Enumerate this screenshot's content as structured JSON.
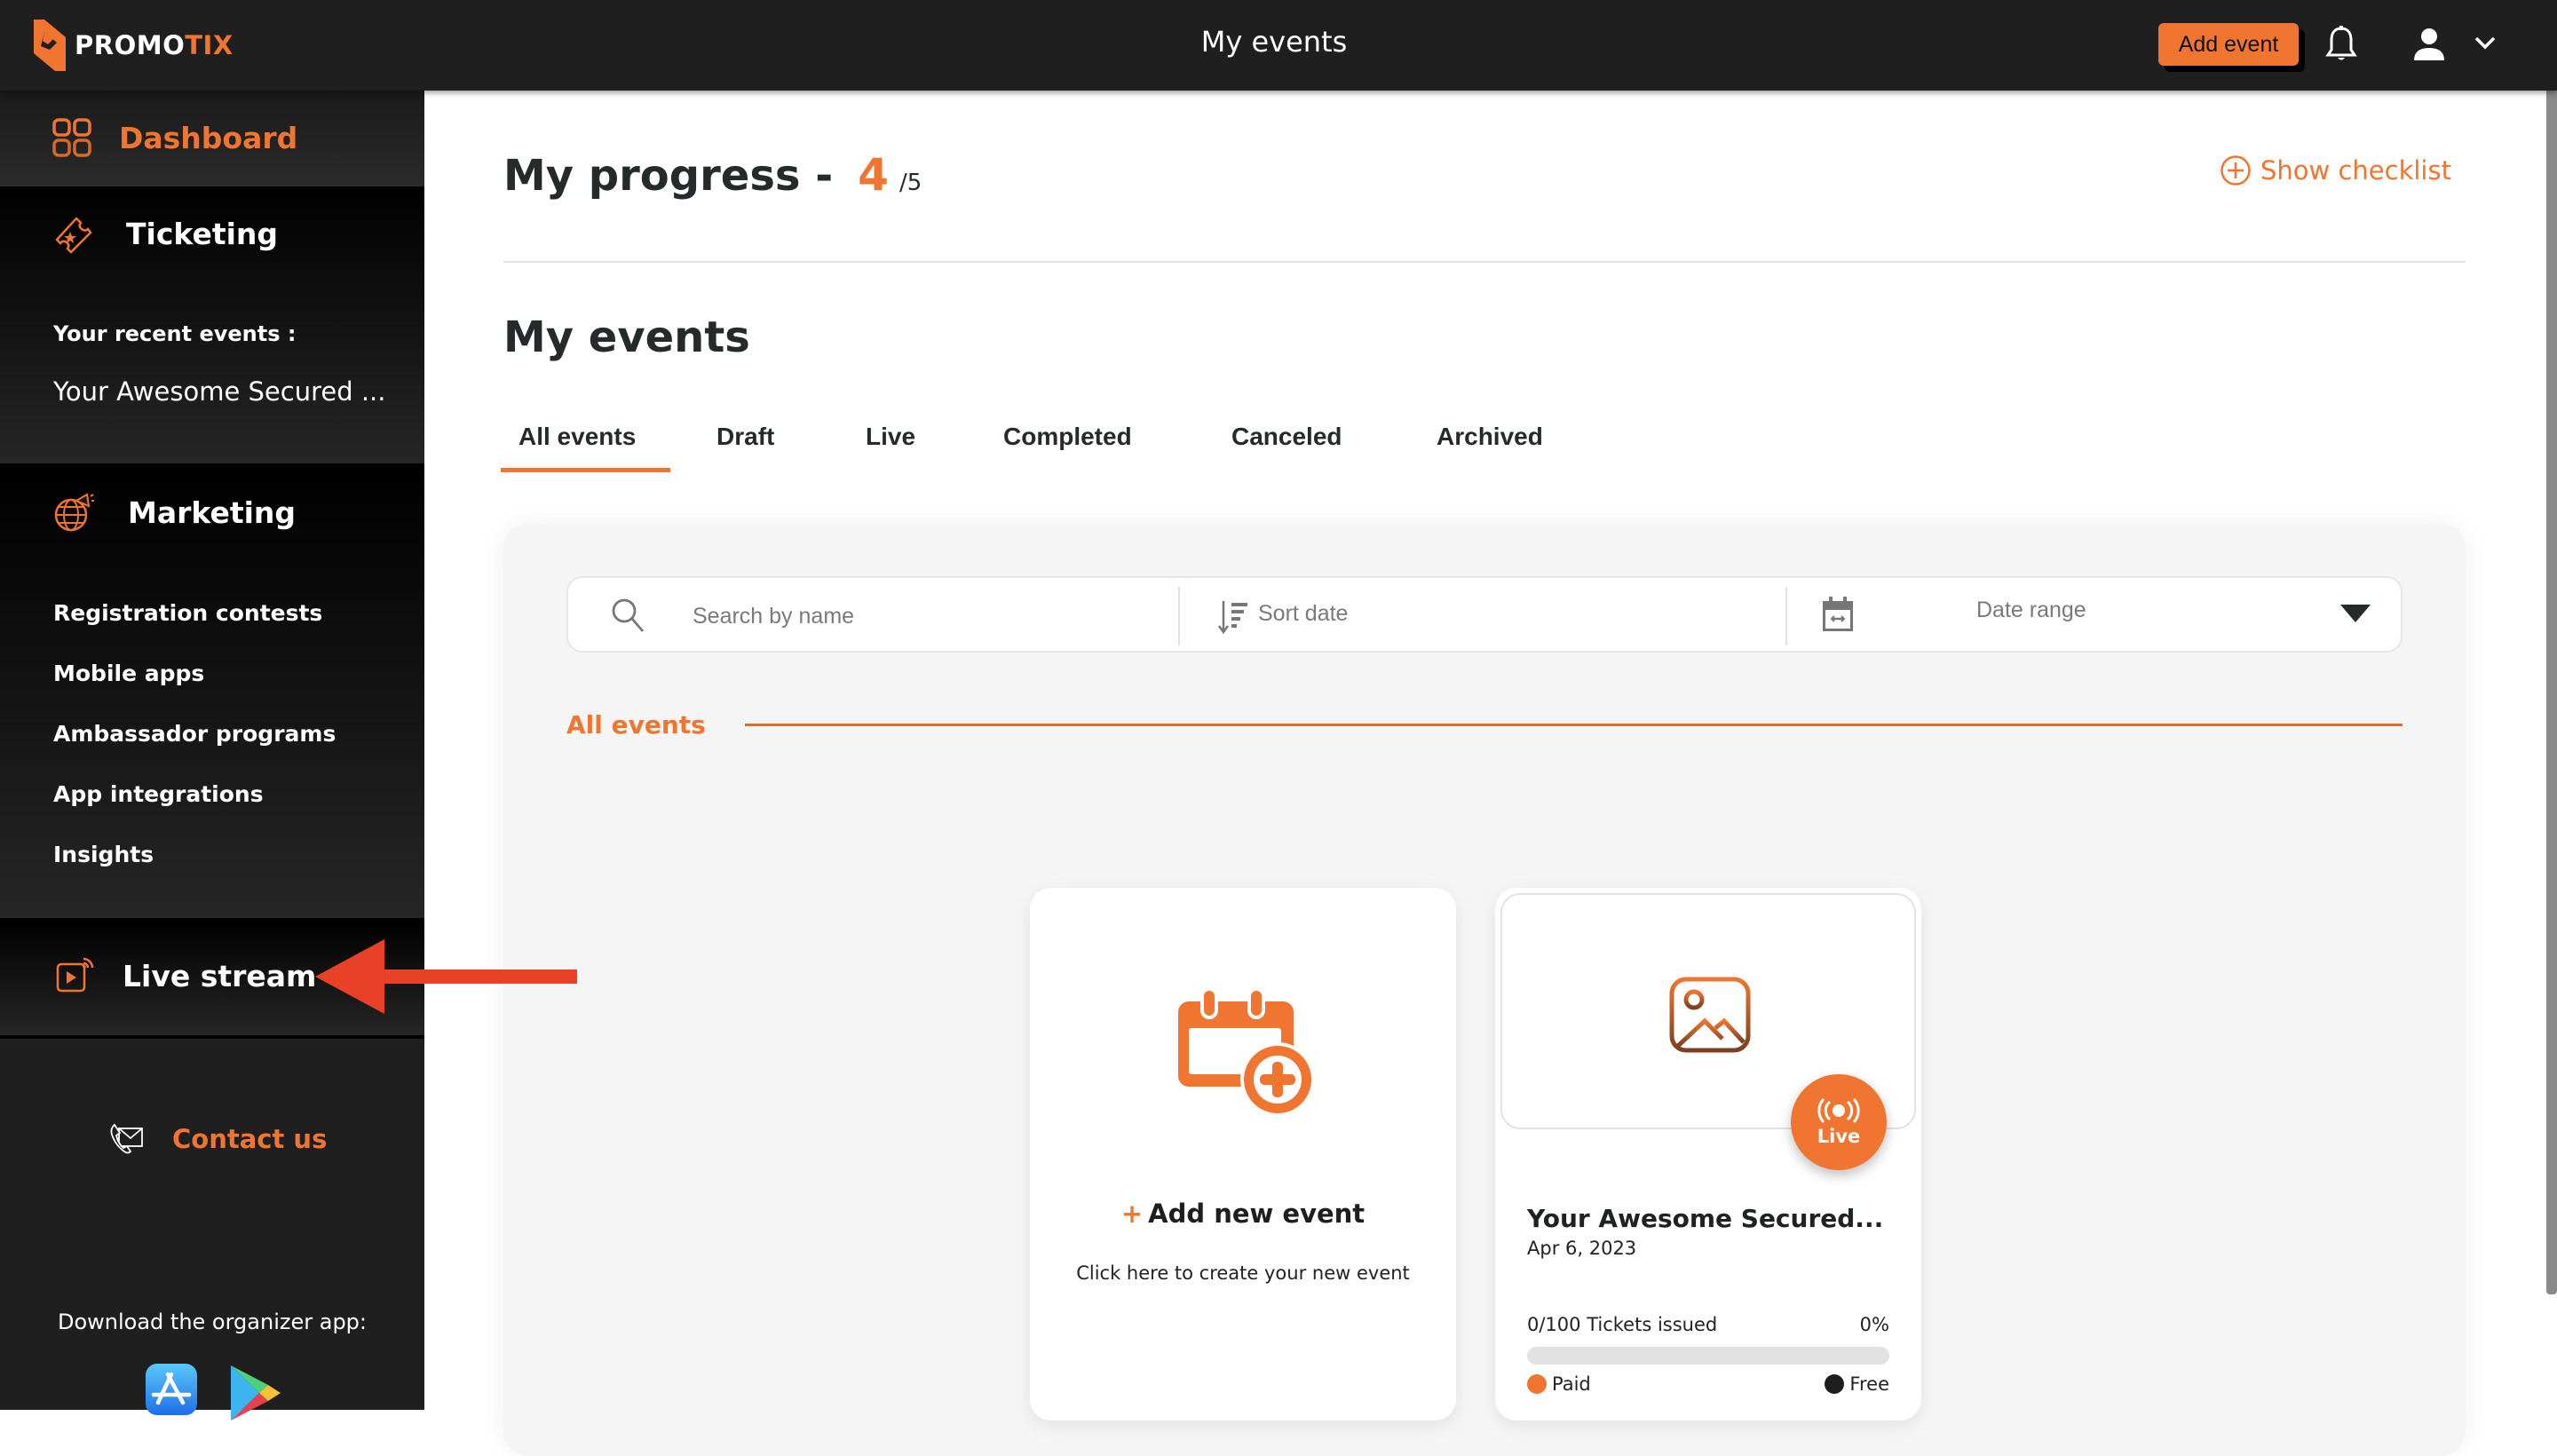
{
  "topbar": {
    "logo_main": "PROMO",
    "logo_accent": "TIX",
    "title": "My events",
    "add_event_label": "Add event",
    "icons": [
      "bell-icon",
      "user-icon",
      "chevron-down-icon"
    ]
  },
  "sidebar": {
    "dashboard": {
      "label": "Dashboard",
      "icon": "dashboard-grid-icon",
      "active": true
    },
    "ticketing": {
      "label": "Ticketing",
      "icon": "ticket-icon",
      "recent_label": "Your recent events :",
      "recent_events": [
        "Your Awesome Secured ..."
      ]
    },
    "marketing": {
      "label": "Marketing",
      "icon": "globe-megaphone-icon",
      "items": [
        {
          "label": "Registration contests"
        },
        {
          "label": "Mobile apps"
        },
        {
          "label": "Ambassador programs"
        },
        {
          "label": "App integrations"
        },
        {
          "label": "Insights"
        }
      ]
    },
    "live_stream": {
      "label": "Live stream",
      "icon": "live-stream-icon"
    },
    "contact": {
      "label": "Contact us",
      "icon": "phone-mail-icon"
    },
    "download_label": "Download the organizer app:",
    "stores": [
      "app-store-icon",
      "google-play-icon"
    ]
  },
  "main": {
    "progress": {
      "title": "My progress -",
      "current": "4",
      "total": "/5"
    },
    "checklist_label": "Show checklist",
    "events_title": "My events",
    "tabs": [
      {
        "label": "All events",
        "active": true
      },
      {
        "label": "Draft",
        "active": false
      },
      {
        "label": "Live",
        "active": false
      },
      {
        "label": "Completed",
        "active": false
      },
      {
        "label": "Canceled",
        "active": false
      },
      {
        "label": "Archived",
        "active": false
      }
    ],
    "filters": {
      "search_placeholder": "Search by name",
      "search_value": "",
      "sort_label": "Sort date",
      "date_range_label": "Date range"
    },
    "section_label": "All events",
    "add_card": {
      "title": "Add new event",
      "plus": "+",
      "subtitle": "Click here to create your new event"
    },
    "event_cards": [
      {
        "title": "Your Awesome Secured...",
        "date": "Apr 6, 2023",
        "status_badge": "Live",
        "tickets_text": "0/100 Tickets issued",
        "percent_text": "0%",
        "progress_fraction": 0,
        "legend": [
          {
            "label": "Paid",
            "color": "#ef7530"
          },
          {
            "label": "Free",
            "color": "#1e1e1e"
          }
        ]
      }
    ]
  },
  "colors": {
    "accent": "#ef7530",
    "topbar_bg": "#1f1f1f",
    "sidebar_bg": "#1f1f1f",
    "text_dark": "#252a2a",
    "annotation_arrow": "#e84128"
  }
}
